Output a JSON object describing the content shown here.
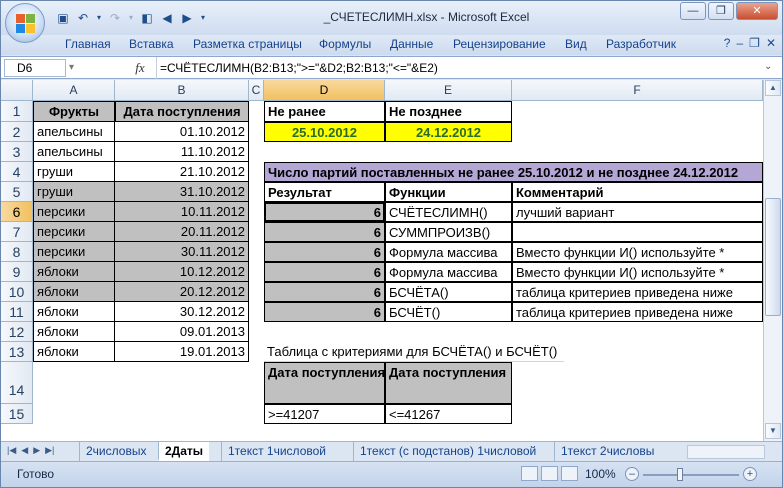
{
  "window": {
    "title": "_СЧЕТЕСЛИМН.xlsx - Microsoft Excel"
  },
  "ribbon": {
    "tabs": [
      "Главная",
      "Вставка",
      "Разметка страницы",
      "Формулы",
      "Данные",
      "Рецензирование",
      "Вид",
      "Разработчик"
    ]
  },
  "formula_bar": {
    "name_box": "D6",
    "fx": "fx",
    "formula": "=СЧЁТЕСЛИМН(B2:B13;\">=\"&D2;B2:B13;\"<=\"&E2)"
  },
  "columns": [
    "A",
    "B",
    "C",
    "D",
    "E",
    "F"
  ],
  "rows": [
    "1",
    "2",
    "3",
    "4",
    "5",
    "6",
    "7",
    "8",
    "9",
    "10",
    "11",
    "12",
    "13",
    "14",
    "15"
  ],
  "table": {
    "header": {
      "fruit": "Фрукты",
      "date": "Дата поступления"
    },
    "rows": [
      {
        "fruit": "апельсины",
        "date": "01.10.2012"
      },
      {
        "fruit": "апельсины",
        "date": "11.10.2012"
      },
      {
        "fruit": "груши",
        "date": "21.10.2012"
      },
      {
        "fruit": "груши",
        "date": "31.10.2012"
      },
      {
        "fruit": "персики",
        "date": "10.11.2012"
      },
      {
        "fruit": "персики",
        "date": "20.11.2012"
      },
      {
        "fruit": "персики",
        "date": "30.11.2012"
      },
      {
        "fruit": "яблоки",
        "date": "10.12.2012"
      },
      {
        "fruit": "яблоки",
        "date": "20.12.2012"
      },
      {
        "fruit": "яблоки",
        "date": "30.12.2012"
      },
      {
        "fruit": "яблоки",
        "date": "09.01.2013"
      },
      {
        "fruit": "яблоки",
        "date": "19.01.2013"
      }
    ]
  },
  "criteria": {
    "not_before_label": "Не ранее",
    "not_after_label": "Не позднее",
    "not_before": "25.10.2012",
    "not_after": "24.12.2012"
  },
  "results": {
    "title": "Число партий поставленных не ранее 25.10.2012 и не позднее 24.12.2012",
    "headers": [
      "Результат",
      "Функции",
      "Комментарий"
    ],
    "rows": [
      {
        "result": "6",
        "func": "СЧЁТЕСЛИМН()",
        "comment": "лучший вариант"
      },
      {
        "result": "6",
        "func": "СУММПРОИЗВ()",
        "comment": ""
      },
      {
        "result": "6",
        "func": "Формула массива",
        "comment": "Вместо функции И() используйте *"
      },
      {
        "result": "6",
        "func": "Формула массива",
        "comment": "Вместо функции И() используйте *"
      },
      {
        "result": "6",
        "func": "БСЧЁТА()",
        "comment": "таблица критериев приведена ниже"
      },
      {
        "result": "6",
        "func": "БСЧЁТ()",
        "comment": "таблица критериев приведена ниже"
      }
    ]
  },
  "crit_table": {
    "caption": "Таблица с критериями для БСЧЁТА() и БСЧЁТ()",
    "h1": "Дата поступления",
    "h2": "Дата поступления",
    "v1": ">=41207",
    "v2": "<=41267"
  },
  "sheets": [
    "2числовых",
    "2Даты",
    "1текст 1числовой",
    "1текст (с подстанов) 1числовой",
    "1текст 2числовы"
  ],
  "status": {
    "ready": "Готово",
    "zoom": "100%"
  },
  "colors": {
    "yellow": "#ffff00",
    "purple": "#b4a7d6",
    "gray": "#c0c0c0",
    "selection": "#f1c15f"
  }
}
